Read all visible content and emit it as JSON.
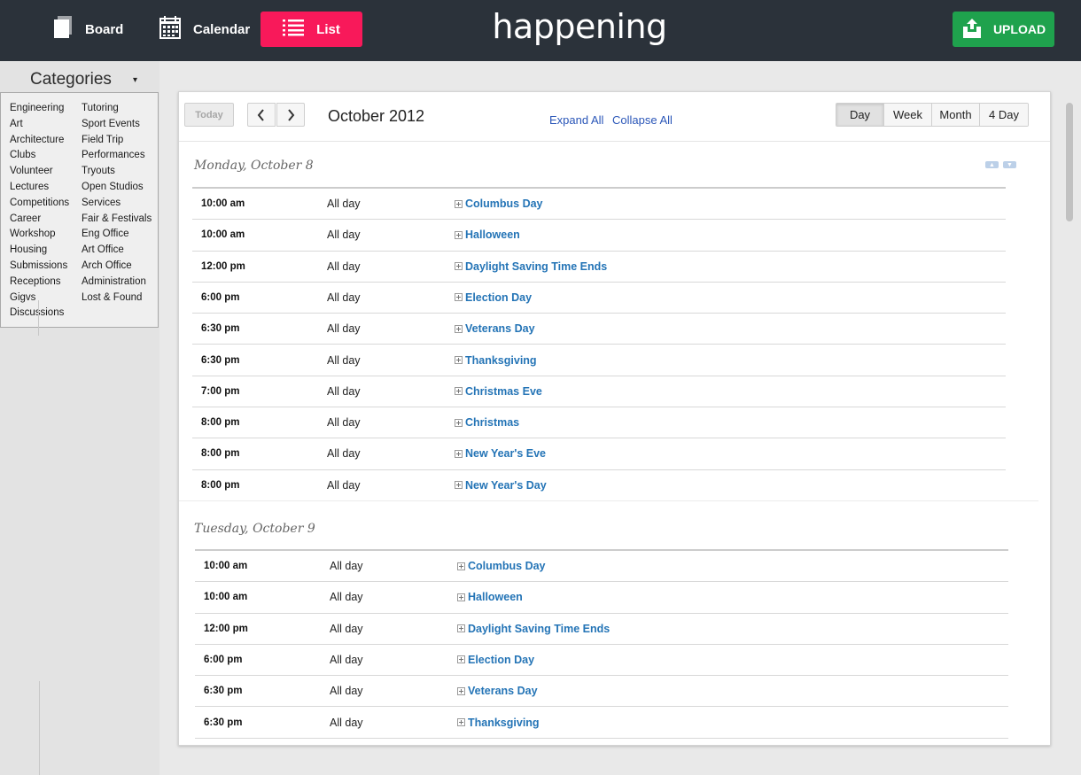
{
  "topbar": {
    "nav": [
      {
        "label": "Board",
        "icon": "board-icon"
      },
      {
        "label": "Calendar",
        "icon": "calendar-icon"
      },
      {
        "label": "List",
        "icon": "list-icon",
        "active": true
      }
    ],
    "brand": "happening",
    "upload_label": "UPLOAD",
    "colors": {
      "bar": "#2b323a",
      "list_active": "#f8195a",
      "upload": "#1fa24d"
    }
  },
  "sidebar": {
    "title": "Categories",
    "arrow": "▾",
    "col1": [
      "Engineering",
      "Art",
      "Architecture",
      "Clubs",
      "Volunteer",
      "Lectures",
      "Competitions",
      "Career",
      "Workshop",
      "Housing",
      "Submissions",
      "Receptions",
      "Gigvs",
      "Discussions"
    ],
    "col2": [
      "Tutoring",
      "Sport Events",
      "Field Trip",
      "Performances",
      "Tryouts",
      "Open Studios",
      "Services",
      "Fair & Festivals",
      "Eng Office",
      "Art Office",
      "Arch Office",
      "Administration",
      "Lost & Found"
    ]
  },
  "toolbar": {
    "today": "Today",
    "month_title": "October 2012",
    "expand_all": "Expand All",
    "collapse_all": "Collapse All",
    "views": [
      "Day",
      "Week",
      "Month",
      "4 Day"
    ],
    "active_view": "Day"
  },
  "days": [
    {
      "heading": "Monday, October 8",
      "events": [
        {
          "time": "10:00 am",
          "allday": "All day",
          "title": "Columbus Day"
        },
        {
          "time": "10:00 am",
          "allday": "All day",
          "title": "Halloween"
        },
        {
          "time": "12:00 pm",
          "allday": "All day",
          "title": "Daylight Saving Time Ends"
        },
        {
          "time": "6:00 pm",
          "allday": "All day",
          "title": "Election Day"
        },
        {
          "time": "6:30 pm",
          "allday": "All day",
          "title": "Veterans Day"
        },
        {
          "time": "6:30 pm",
          "allday": "All day",
          "title": "Thanksgiving"
        },
        {
          "time": "7:00 pm",
          "allday": "All day",
          "title": "Christmas Eve"
        },
        {
          "time": "8:00 pm",
          "allday": "All day",
          "title": "Christmas"
        },
        {
          "time": "8:00 pm",
          "allday": "All day",
          "title": "New Year's Eve"
        },
        {
          "time": "8:00 pm",
          "allday": "All day",
          "title": "New Year's Day"
        }
      ]
    },
    {
      "heading": "Tuesday, October 9",
      "events": [
        {
          "time": "10:00 am",
          "allday": "All day",
          "title": "Columbus Day"
        },
        {
          "time": "10:00 am",
          "allday": "All day",
          "title": "Halloween"
        },
        {
          "time": "12:00 pm",
          "allday": "All day",
          "title": "Daylight Saving Time Ends"
        },
        {
          "time": "6:00 pm",
          "allday": "All day",
          "title": "Election Day"
        },
        {
          "time": "6:30 pm",
          "allday": "All day",
          "title": "Veterans Day"
        },
        {
          "time": "6:30 pm",
          "allday": "All day",
          "title": "Thanksgiving"
        }
      ]
    }
  ]
}
